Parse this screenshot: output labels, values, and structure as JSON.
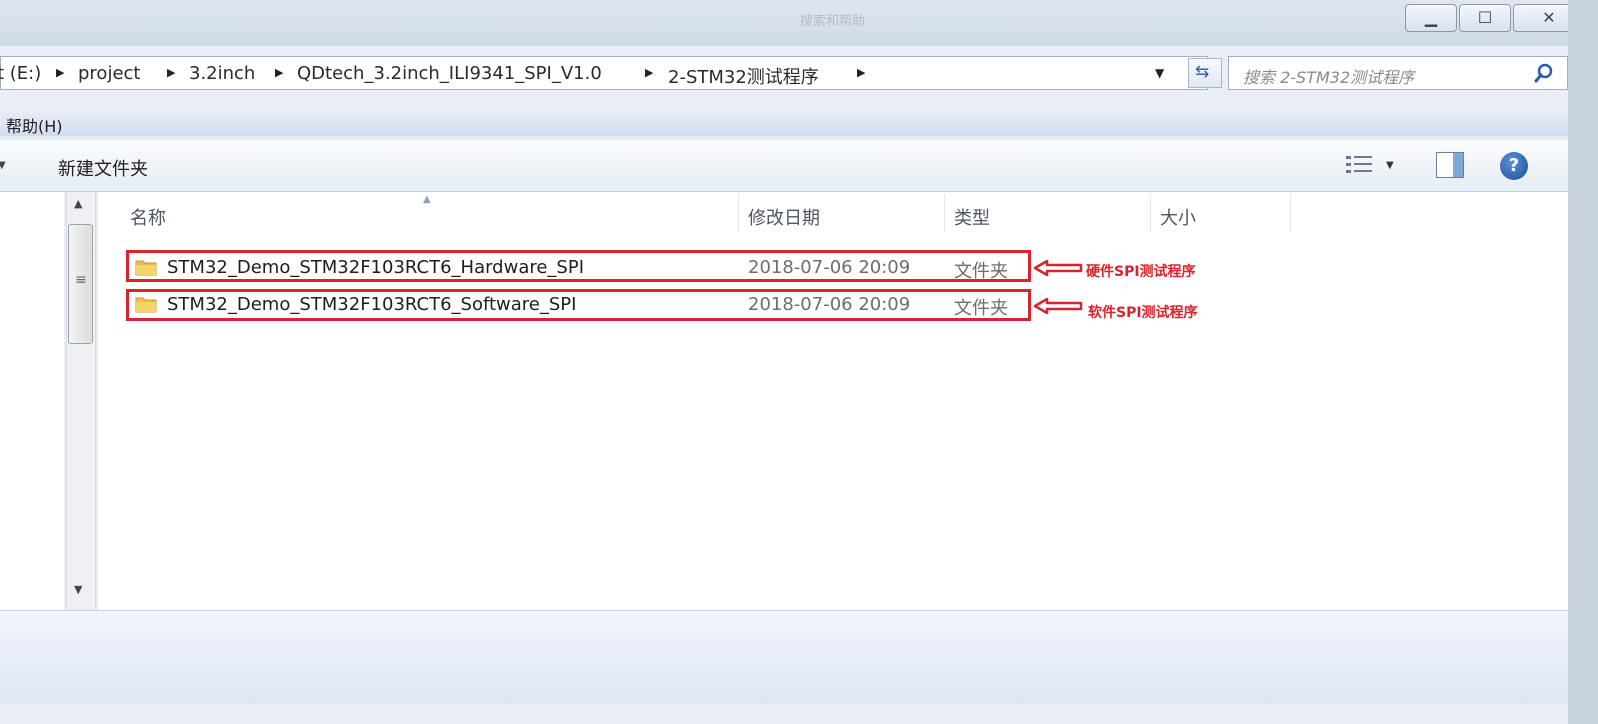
{
  "window": {
    "title": "搜索和帮助"
  },
  "address": {
    "crumbs": [
      "t (E:)",
      "project",
      "3.2inch",
      "QDtech_3.2inch_ILI9341_SPI_V1.0",
      "2-STM32测试程序"
    ]
  },
  "search": {
    "placeholder": "搜索 2-STM32测试程序"
  },
  "menu": {
    "help": "帮助(H)"
  },
  "toolbar": {
    "new_folder": "新建文件夹"
  },
  "columns": {
    "name": "名称",
    "modified": "修改日期",
    "type": "类型",
    "size": "大小"
  },
  "files": [
    {
      "name": "STM32_Demo_STM32F103RCT6_Hardware_SPI",
      "modified": "2018-07-06 20:09",
      "type": "文件夹"
    },
    {
      "name": "STM32_Demo_STM32F103RCT6_Software_SPI",
      "modified": "2018-07-06 20:09",
      "type": "文件夹"
    }
  ],
  "annotations": [
    "硬件SPI测试程序",
    "软件SPI测试程序"
  ],
  "colors": {
    "annotation": "#d9232e",
    "folder": "#e8c04a"
  }
}
